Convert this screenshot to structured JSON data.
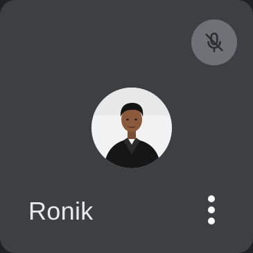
{
  "participant": {
    "name": "Ronik",
    "avatar_icon": "profile-photo",
    "mic_status_icon": "mic-off-icon"
  },
  "actions": {
    "more_options_icon": "more-vert-icon"
  },
  "colors": {
    "tile_background": "#3c4043",
    "badge_background": "#6e7175",
    "name_text": "#e8eaed"
  }
}
